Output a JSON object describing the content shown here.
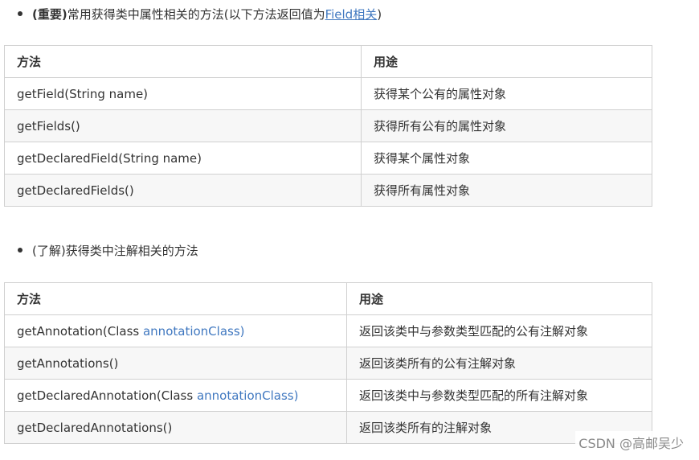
{
  "section1": {
    "bold_prefix": "(重要)",
    "text": "常用获得类中属性相关的方法(以下方法返回值为",
    "link": "Field相关",
    "suffix": ")"
  },
  "table1": {
    "headers": [
      "方法",
      "用途"
    ],
    "rows": [
      {
        "method": "getField(String name)",
        "usage": "获得某个公有的属性对象"
      },
      {
        "method": "getFields()",
        "usage": "获得所有公有的属性对象"
      },
      {
        "method": "getDeclaredField(String name)",
        "usage": "获得某个属性对象"
      },
      {
        "method": "getDeclaredFields()",
        "usage": "获得所有属性对象"
      }
    ]
  },
  "section2": {
    "text": "(了解)获得类中注解相关的方法"
  },
  "table2": {
    "headers": [
      "方法",
      "用途"
    ],
    "rows": [
      {
        "method": "getAnnotation(Class ",
        "method_accent": "annotationClass)",
        "usage": "返回该类中与参数类型匹配的公有注解对象"
      },
      {
        "method": "getAnnotations()",
        "method_accent": "",
        "usage": "返回该类所有的公有注解对象"
      },
      {
        "method": "getDeclaredAnnotation(Class ",
        "method_accent": "annotationClass)",
        "usage": "返回该类中与参数类型匹配的所有注解对象"
      },
      {
        "method": "getDeclaredAnnotations()",
        "method_accent": "",
        "usage": "返回该类所有的注解对象"
      }
    ]
  },
  "watermark": "CSDN @高邮吴少",
  "colors": {
    "link": "#4078c0",
    "border": "#d0d0d0",
    "stripe": "#f7f7f7"
  }
}
